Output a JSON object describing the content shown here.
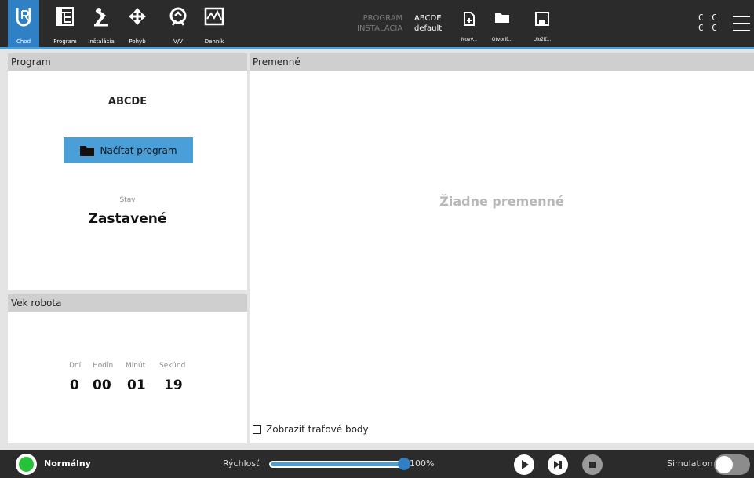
{
  "header": {
    "nav": [
      {
        "label": "Chod",
        "icon": "ur-logo-icon"
      },
      {
        "label": "Program",
        "icon": "program-tree-icon"
      },
      {
        "label": "Inštalácia",
        "icon": "robot-arm-icon"
      },
      {
        "label": "Pohyb",
        "icon": "move-arrows-icon"
      },
      {
        "label": "V/V",
        "icon": "io-icon"
      },
      {
        "label": "Denník",
        "icon": "log-icon"
      }
    ],
    "program_key": "PROGRAM",
    "program_value": "ABCDE",
    "installation_key": "INŠTALÁCIA",
    "installation_value": "default",
    "file_buttons": [
      {
        "label": "Nový...",
        "icon": "new-file-icon"
      },
      {
        "label": "Otvoriť...",
        "icon": "folder-icon"
      },
      {
        "label": "Uložiť...",
        "icon": "save-icon"
      }
    ],
    "cc_line1": "C C",
    "cc_line2": "C C",
    "accent_color": "#2f80c5"
  },
  "program_panel": {
    "title": "Program",
    "program_name": "ABCDE",
    "load_button": "Načítať program",
    "state_label": "Stav",
    "state_value": "Zastavené"
  },
  "robot_age": {
    "title": "Vek robota",
    "labels": [
      "Dní",
      "Hodín",
      "Minút",
      "Sekúnd"
    ],
    "values": [
      "0",
      "00",
      "01",
      "19"
    ]
  },
  "variables": {
    "title": "Premenné",
    "empty_text": "Žiadne premenné",
    "checkbox_label": "Zobraziť traťové body",
    "checkbox_checked": false
  },
  "footer": {
    "status_text": "Normálny",
    "status_color": "#27c23a",
    "speed_label": "Rýchlosť",
    "speed_value": "100%",
    "speed_fraction": 1.0,
    "simulation_label": "Simulation",
    "simulation_on": false
  }
}
